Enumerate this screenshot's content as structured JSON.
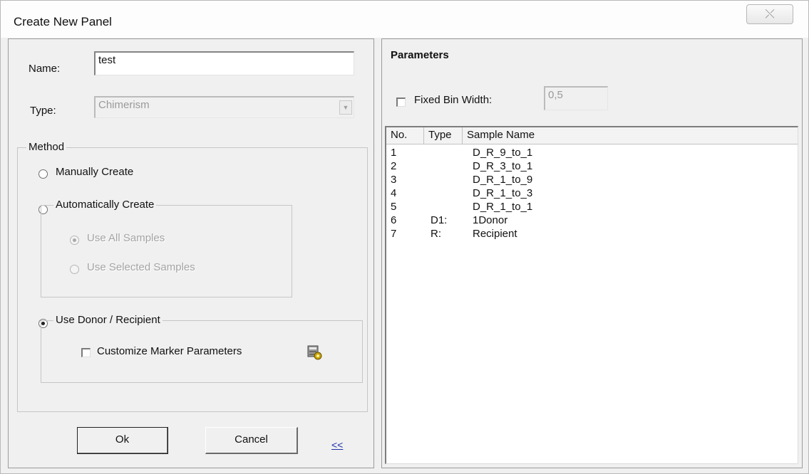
{
  "window": {
    "title": "Create New Panel",
    "close_glyph": "⤬"
  },
  "form": {
    "name_label": "Name:",
    "name_value": "test",
    "type_label": "Type:",
    "type_value": "Chimerism"
  },
  "method": {
    "legend": "Method",
    "manual_label": "Manually Create",
    "auto_label": "Automatically Create",
    "use_all_label": "Use All Samples",
    "use_selected_label": "Use Selected Samples",
    "donor_label": "Use Donor / Recipient",
    "customize_label": "Customize Marker Parameters",
    "selected": "donor"
  },
  "buttons": {
    "ok": "Ok",
    "cancel": "Cancel",
    "collapse": "<<"
  },
  "parameters": {
    "title": "Parameters",
    "fixed_bin_label": "Fixed Bin Width:",
    "fixed_bin_value": "0,5",
    "fixed_bin_checked": false
  },
  "samples": {
    "columns": [
      "No.",
      "Type",
      "Sample Name"
    ],
    "rows": [
      {
        "no": "1",
        "type": "",
        "name": "D_R_9_to_1"
      },
      {
        "no": "2",
        "type": "",
        "name": "D_R_3_to_1"
      },
      {
        "no": "3",
        "type": "",
        "name": "D_R_1_to_9"
      },
      {
        "no": "4",
        "type": "",
        "name": "D_R_1_to_3"
      },
      {
        "no": "5",
        "type": "",
        "name": "D_R_1_to_1"
      },
      {
        "no": "6",
        "type": "D1:",
        "name": "1Donor"
      },
      {
        "no": "7",
        "type": "R:",
        "name": "Recipient"
      }
    ]
  },
  "icons": {
    "customize": "marker-settings-icon"
  }
}
